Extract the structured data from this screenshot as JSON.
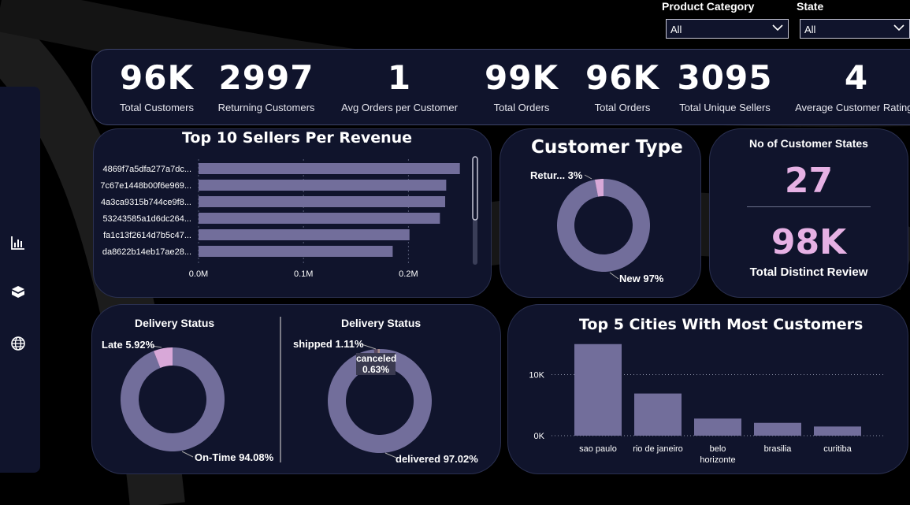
{
  "filters": [
    {
      "label": "Product Category",
      "value": "All"
    },
    {
      "label": "State",
      "value": "All"
    }
  ],
  "kpis": [
    {
      "value": "96K",
      "label": "Total Customers"
    },
    {
      "value": "2997",
      "label": "Returning Customers"
    },
    {
      "value": "1",
      "label": "Avg Orders per Customer"
    },
    {
      "value": "99K",
      "label": "Total Orders"
    },
    {
      "value": "96K",
      "label": "Total Orders"
    },
    {
      "value": "3095",
      "label": "Total Unique Sellers"
    },
    {
      "value": "4",
      "label": "Average Customer Ratings"
    }
  ],
  "sidebar": {
    "icons": [
      "bar-chart-icon",
      "box-icon",
      "globe-icon"
    ]
  },
  "colors": {
    "accent": "#726e9b",
    "highlight": "#d8a8d8",
    "panel": "#10142c",
    "kpi_highlight": "#e6b1e4"
  },
  "states_card": {
    "title": "No of Customer States",
    "states_value": "27",
    "reviews_value": "98K",
    "reviews_label": "Total Distinct Review"
  },
  "chart_data": [
    {
      "type": "bar",
      "orientation": "horizontal",
      "title": "Top 10 Sellers Per Revenue",
      "categories": [
        "4869f7a5dfa277a7dc...",
        "7c67e1448b00f6e969...",
        "4a3ca9315b744ce9f8...",
        "53243585a1d6dc264...",
        "fa1c13f2614d7b5c47...",
        "da8622b14eb17ae28..."
      ],
      "values": [
        0.249,
        0.236,
        0.235,
        0.23,
        0.201,
        0.185
      ],
      "x_ticks": [
        "0.0M",
        "0.1M",
        "0.2M"
      ],
      "xlim": [
        0,
        0.25
      ],
      "scrollbar": true
    },
    {
      "type": "pie",
      "donut": true,
      "title": "Customer Type",
      "slices": [
        {
          "label": "Retur... 3%",
          "value": 3,
          "color": "#d8a8d8"
        },
        {
          "label": "New 97%",
          "value": 97,
          "color": "#726e9b"
        }
      ]
    },
    {
      "type": "pie",
      "donut": true,
      "title": "Delivery Status",
      "slices": [
        {
          "label": "Late 5.92%",
          "value": 5.92,
          "color": "#d8a8d8"
        },
        {
          "label": "On-Time 94.08%",
          "value": 94.08,
          "color": "#726e9b"
        }
      ]
    },
    {
      "type": "pie",
      "donut": true,
      "title": "Delivery Status",
      "slices": [
        {
          "label": "shipped 1.11%",
          "value": 1.11,
          "color": "#5b4a64"
        },
        {
          "label": "canceled 0.63%",
          "value": 0.63,
          "color": "#a58a8a"
        },
        {
          "label": "delivered 97.02%",
          "value": 97.02,
          "color": "#726e9b"
        }
      ]
    },
    {
      "type": "bar",
      "title": "Top 5 Cities With Most Customers",
      "categories": [
        "sao paulo",
        "rio de janeiro",
        "belo horizonte",
        "brasilia",
        "curitiba"
      ],
      "values": [
        15000,
        6900,
        2800,
        2100,
        1500
      ],
      "y_ticks": [
        "10K",
        "0K"
      ],
      "ylim": [
        0,
        16000
      ]
    }
  ]
}
